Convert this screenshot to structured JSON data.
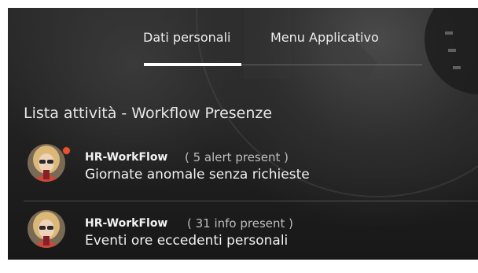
{
  "tabs": [
    {
      "label": "Dati personali",
      "active": true
    },
    {
      "label": "Menu Applicativo",
      "active": false
    }
  ],
  "section_title": "Lista attività - Workflow Presenze",
  "items": [
    {
      "source": "HR-WorkFlow",
      "count_text": "( 5 alert present )",
      "description": "Giornate anomale senza richieste",
      "has_alert_dot": true,
      "alert_color": "#e8522d"
    },
    {
      "source": "HR-WorkFlow",
      "count_text": "( 31 info present )",
      "description": "Eventi ore eccedenti personali",
      "has_alert_dot": false
    }
  ],
  "icons": {
    "avatar": "user-avatar-icon",
    "alert": "alert-dot-icon"
  },
  "colors": {
    "background": "#222222",
    "text": "#f0f0f0",
    "muted": "#bdbdbd",
    "underline": "#ffffff",
    "alert": "#e8522d"
  }
}
